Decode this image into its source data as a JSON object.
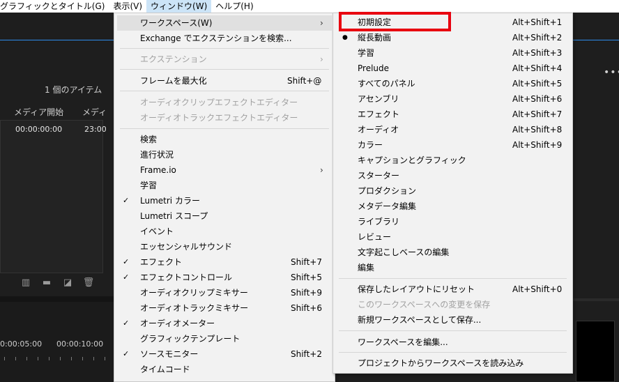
{
  "menubar": {
    "items": [
      {
        "label": "グラフィックとタイトル(G)",
        "active": false
      },
      {
        "label": "表示(V)",
        "active": false
      },
      {
        "label": "ウィンドウ(W)",
        "active": true
      },
      {
        "label": "ヘルプ(H)",
        "active": false
      }
    ]
  },
  "project_panel": {
    "item_count": "1 個のアイテム",
    "columns": [
      "メディア開始",
      "メディ"
    ],
    "row": {
      "start": "00:00:00:00",
      "end": "23:00"
    }
  },
  "timeline": {
    "marks": [
      "0:00:05:00",
      "00:00:10:00"
    ]
  },
  "window_menu": {
    "items": [
      {
        "label": "ワークスペース(W)",
        "shortcut": "",
        "submenu": true,
        "highlighted": true
      },
      {
        "label": "Exchange でエクステンションを検索...",
        "shortcut": ""
      },
      {
        "label": "エクステンション",
        "shortcut": "",
        "submenu": true,
        "disabled": true
      },
      {
        "label": "フレームを最大化",
        "shortcut": "Shift+@"
      },
      {
        "label": "オーディオクリップエフェクトエディター",
        "shortcut": "",
        "disabled": true
      },
      {
        "label": "オーディオトラックエフェクトエディター",
        "shortcut": "",
        "disabled": true
      },
      {
        "label": "検索",
        "shortcut": ""
      },
      {
        "label": "進行状況",
        "shortcut": ""
      },
      {
        "label": "Frame.io",
        "shortcut": "",
        "submenu": true
      },
      {
        "label": "学習",
        "shortcut": ""
      },
      {
        "label": "Lumetri カラー",
        "shortcut": "",
        "checked": true
      },
      {
        "label": "Lumetri スコープ",
        "shortcut": ""
      },
      {
        "label": "イベント",
        "shortcut": ""
      },
      {
        "label": "エッセンシャルサウンド",
        "shortcut": ""
      },
      {
        "label": "エフェクト",
        "shortcut": "Shift+7",
        "checked": true
      },
      {
        "label": "エフェクトコントロール",
        "shortcut": "Shift+5",
        "checked": true
      },
      {
        "label": "オーディオクリップミキサー",
        "shortcut": "Shift+9"
      },
      {
        "label": "オーディオトラックミキサー",
        "shortcut": "Shift+6"
      },
      {
        "label": "オーディオメーター",
        "shortcut": "",
        "checked": true
      },
      {
        "label": "グラフィックテンプレート",
        "shortcut": ""
      },
      {
        "label": "ソースモニター",
        "shortcut": "Shift+2",
        "checked": true
      },
      {
        "label": "タイムコード",
        "shortcut": ""
      }
    ]
  },
  "workspace_menu": {
    "items": [
      {
        "label": "初期設定",
        "shortcut": "Alt+Shift+1",
        "boxed": true
      },
      {
        "label": "縦長動画",
        "shortcut": "Alt+Shift+2",
        "current": true
      },
      {
        "label": "学習",
        "shortcut": "Alt+Shift+3"
      },
      {
        "label": "Prelude",
        "shortcut": "Alt+Shift+4"
      },
      {
        "label": "すべてのパネル",
        "shortcut": "Alt+Shift+5"
      },
      {
        "label": "アセンブリ",
        "shortcut": "Alt+Shift+6"
      },
      {
        "label": "エフェクト",
        "shortcut": "Alt+Shift+7"
      },
      {
        "label": "オーディオ",
        "shortcut": "Alt+Shift+8"
      },
      {
        "label": "カラー",
        "shortcut": "Alt+Shift+9"
      },
      {
        "label": "キャプションとグラフィック",
        "shortcut": ""
      },
      {
        "label": "スターター",
        "shortcut": ""
      },
      {
        "label": "プロダクション",
        "shortcut": ""
      },
      {
        "label": "メタデータ編集",
        "shortcut": ""
      },
      {
        "label": "ライブラリ",
        "shortcut": ""
      },
      {
        "label": "レビュー",
        "shortcut": ""
      },
      {
        "label": "文字起こしベースの編集",
        "shortcut": ""
      },
      {
        "label": "編集",
        "shortcut": ""
      },
      {
        "label": "保存したレイアウトにリセット",
        "shortcut": "Alt+Shift+0"
      },
      {
        "label": "このワークスペースへの変更を保存",
        "shortcut": "",
        "disabled": true
      },
      {
        "label": "新規ワークスペースとして保存...",
        "shortcut": ""
      },
      {
        "label": "ワークスペースを編集...",
        "shortcut": ""
      },
      {
        "label": "プロジェクトからワークスペースを読み込み",
        "shortcut": ""
      }
    ]
  },
  "colors": {
    "highlight_box": "#e8000f",
    "accent_line": "#2d8ceb"
  }
}
